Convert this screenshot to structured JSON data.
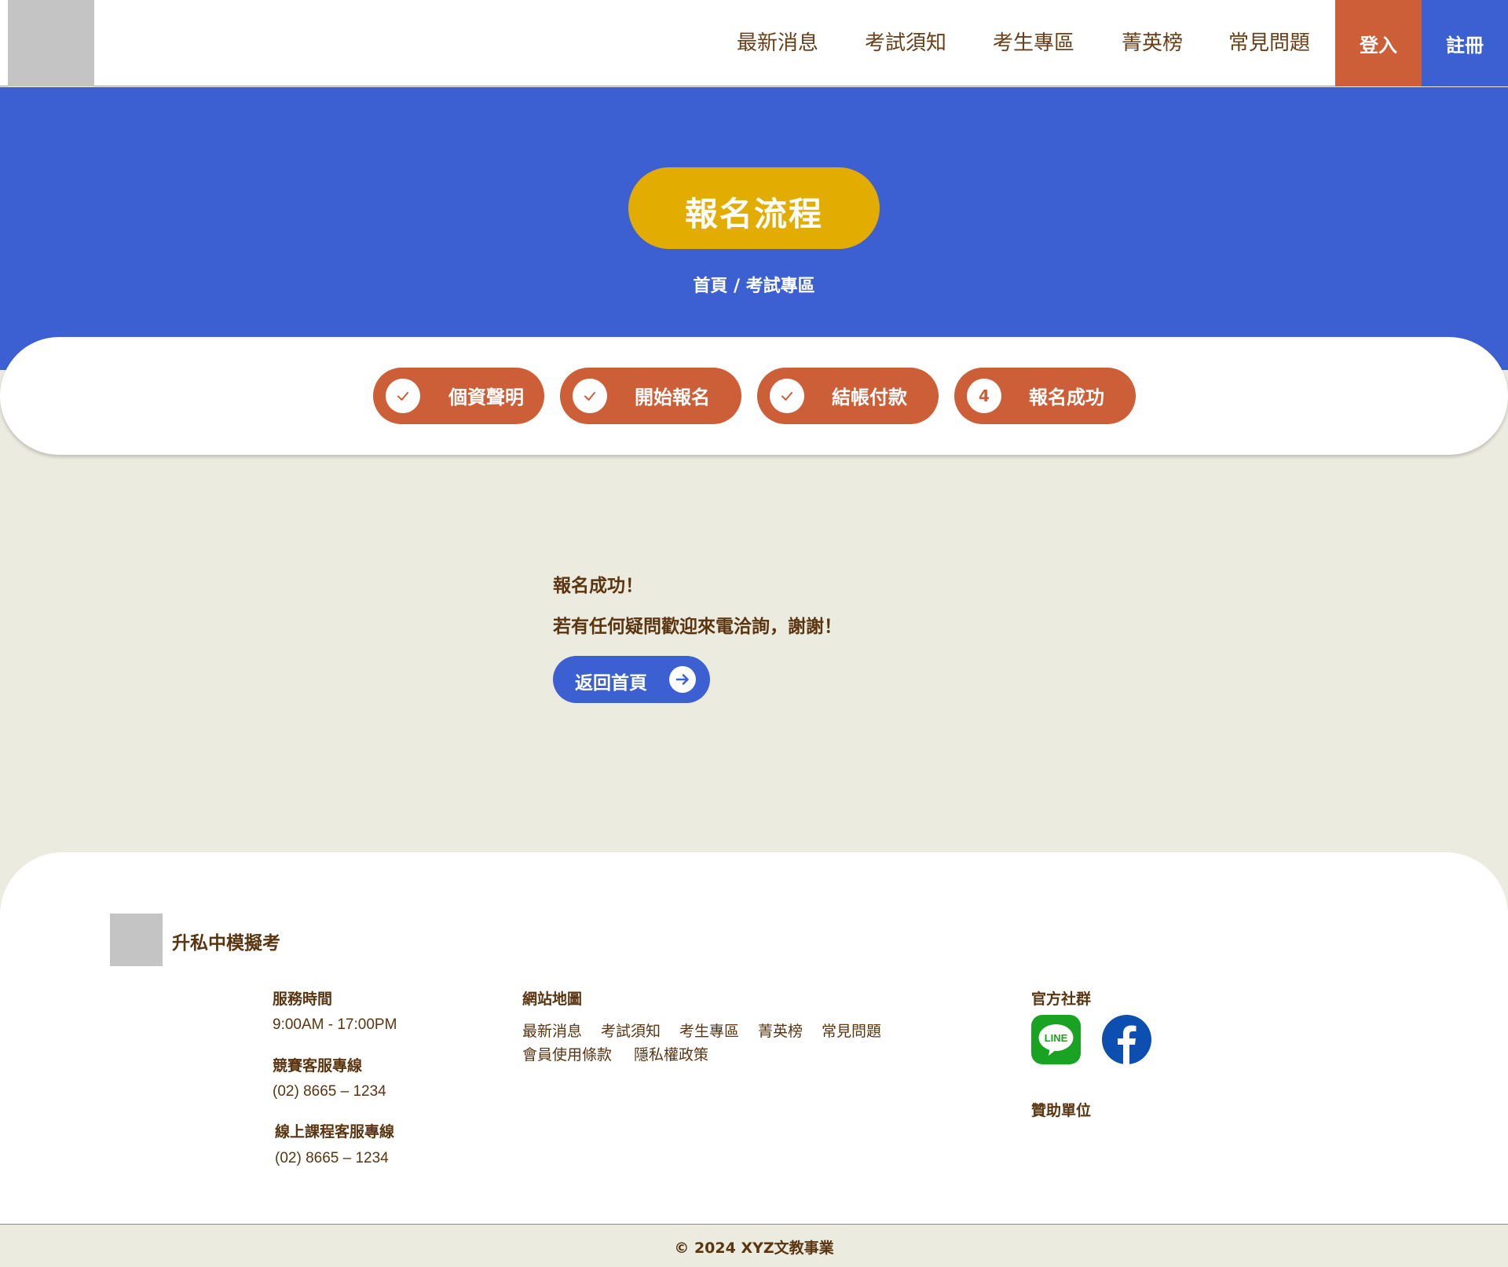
{
  "header": {
    "nav": [
      "最新消息",
      "考試須知",
      "考生專區",
      "菁英榜",
      "常見問題"
    ],
    "login_label": "登入",
    "register_label": "註冊"
  },
  "hero": {
    "title": "報名流程",
    "breadcrumb": "首頁 / 考試專區"
  },
  "steps": [
    {
      "icon": "check-icon",
      "label": "個資聲明"
    },
    {
      "icon": "check-icon",
      "label": "開始報名"
    },
    {
      "icon": "check-icon",
      "label": "結帳付款"
    },
    {
      "number": "4",
      "label": "報名成功"
    }
  ],
  "result": {
    "line1": "報名成功！",
    "line2": "若有任何疑問歡迎來電洽詢，謝謝！",
    "home_button": "返回首頁"
  },
  "footer": {
    "brand": "升私中模擬考",
    "service_hours_title": "服務時間",
    "service_hours": "9:00AM - 17:00PM",
    "contest_line_title": "競賽客服專線",
    "contest_line": "(02) 8665 – 1234",
    "course_line_title": "線上課程客服專線",
    "course_line": "(02) 8665 – 1234",
    "sitemap_title": "網站地圖",
    "sitemap_row1": [
      "最新消息",
      "考試須知",
      "考生專區",
      "菁英榜",
      "常見問題"
    ],
    "sitemap_row2": [
      "會員使用條款",
      "隱私權政策"
    ],
    "social_title": "官方社群",
    "social": [
      "line-icon",
      "facebook-icon"
    ],
    "sponsor_title": "贊助單位",
    "copyright": "© 2024 XYZ文教事業"
  },
  "colors": {
    "primary_blue": "#3c5fd1",
    "accent_orange": "#cc5e38",
    "title_yellow": "#e2ad00",
    "background": "#ebebe0",
    "text_brown": "#6a3f17"
  }
}
